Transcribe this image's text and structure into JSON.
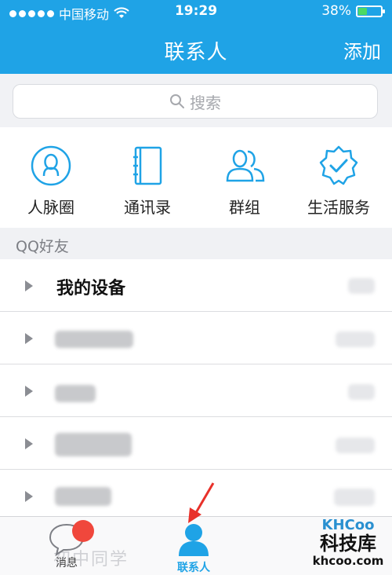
{
  "status_bar": {
    "carrier": "中国移动",
    "time": "19:29",
    "battery_percent": "38%",
    "battery_level": 0.38
  },
  "nav": {
    "title": "联系人",
    "add_label": "添加"
  },
  "search": {
    "placeholder": "搜索"
  },
  "quick_actions": [
    {
      "label": "人脉圈",
      "icon": "person-circle-icon"
    },
    {
      "label": "通讯录",
      "icon": "address-book-icon"
    },
    {
      "label": "群组",
      "icon": "group-icon"
    },
    {
      "label": "生活服务",
      "icon": "badge-check-icon"
    }
  ],
  "section": {
    "title": "QQ好友"
  },
  "groups": [
    {
      "name": "我的设备"
    }
  ],
  "tabbar": {
    "messages_label": "消息",
    "contacts_label": "联系人",
    "ghost_text": "初中同学"
  },
  "watermark": {
    "brand": "KHCoo",
    "name": "科技库",
    "url": "khcoo.com"
  },
  "colors": {
    "accent": "#1fa3e6",
    "badge": "#f0473c"
  }
}
